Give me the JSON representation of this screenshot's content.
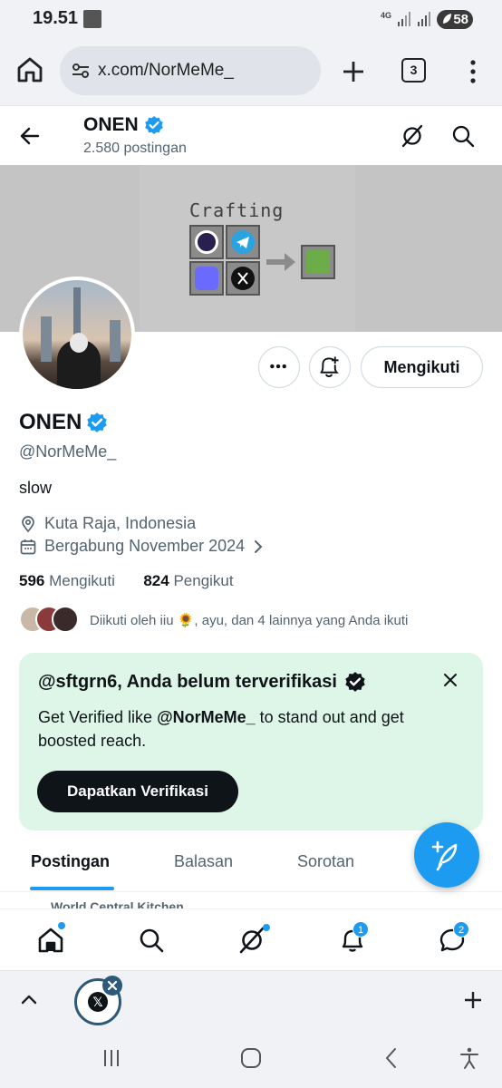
{
  "status_bar": {
    "time": "19.51",
    "network": "4G",
    "battery": "58"
  },
  "browser": {
    "url": "x.com/NorMeMe_",
    "tab_count": "3"
  },
  "header": {
    "name": "ONEN",
    "post_count": "2.580 postingan"
  },
  "banner": {
    "title": "Crafting"
  },
  "profile": {
    "name": "ONEN",
    "handle": "@NorMeMe_",
    "bio": "slow",
    "location": "Kuta Raja, Indonesia",
    "joined": "Bergabung November 2024",
    "following_count": "596",
    "following_label": "Mengikuti",
    "followers_count": "824",
    "followers_label": "Pengikut",
    "followed_by": "Diikuti oleh iiu 🌻, ayu, dan 4 lainnya yang Anda ikuti",
    "follow_button": "Mengikuti"
  },
  "verify_card": {
    "title": "@sftgrn6, Anda belum terverifikasi",
    "text_prefix": "Get Verified like ",
    "text_handle": "@NorMeMe_",
    "text_suffix": " to stand out and get boosted reach.",
    "button": "Dapatkan Verifikasi"
  },
  "tabs": [
    {
      "label": "Postingan",
      "active": true
    },
    {
      "label": "Balasan",
      "active": false
    },
    {
      "label": "Sorotan",
      "active": false
    }
  ],
  "peek_text": "World Central Kitchen",
  "bottom_nav": {
    "notifications_badge": "1",
    "messages_badge": "2"
  },
  "colors": {
    "accent": "#1d9bf0",
    "verify_bg": "#def6e8",
    "dark": "#0f1419",
    "muted": "#536471"
  }
}
